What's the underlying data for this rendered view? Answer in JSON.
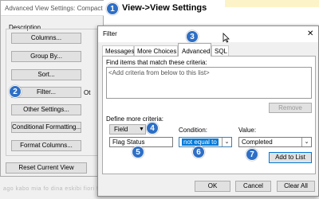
{
  "annotation": {
    "step1_title": "View->View Settings"
  },
  "markers": [
    "1",
    "2",
    "3",
    "4",
    "5",
    "6",
    "7"
  ],
  "back_dialog": {
    "title": "Advanced View Settings: Compact",
    "group_label": "Description",
    "buttons": [
      "Columns...",
      "Group By...",
      "Sort...",
      "Filter...",
      "Other Settings...",
      "Conditional Formatting...",
      "Format Columns..."
    ],
    "side_texts": [
      "Ot"
    ],
    "reset_label": "Reset Current View",
    "bottom_text": "ago kabo mia fo dina eskibi fiori fra"
  },
  "filter_dialog": {
    "title": "Filter",
    "close_label": "✕",
    "tabs": [
      "Messages",
      "More Choices",
      "Advanced",
      "SQL"
    ],
    "active_tab": "Advanced",
    "criteria_label": "Find items that match these criteria:",
    "criteria_placeholder": "<Add criteria from below to this list>",
    "remove_label": "Remove",
    "define_label": "Define more criteria:",
    "field_label": "Field",
    "field_value": "Flag Status",
    "condition_label": "Condition:",
    "condition_value": "not equal to",
    "value_label": "Value:",
    "value_value": "Completed",
    "add_label": "Add to List",
    "ok_label": "OK",
    "cancel_label": "Cancel",
    "clear_label": "Clear All"
  }
}
